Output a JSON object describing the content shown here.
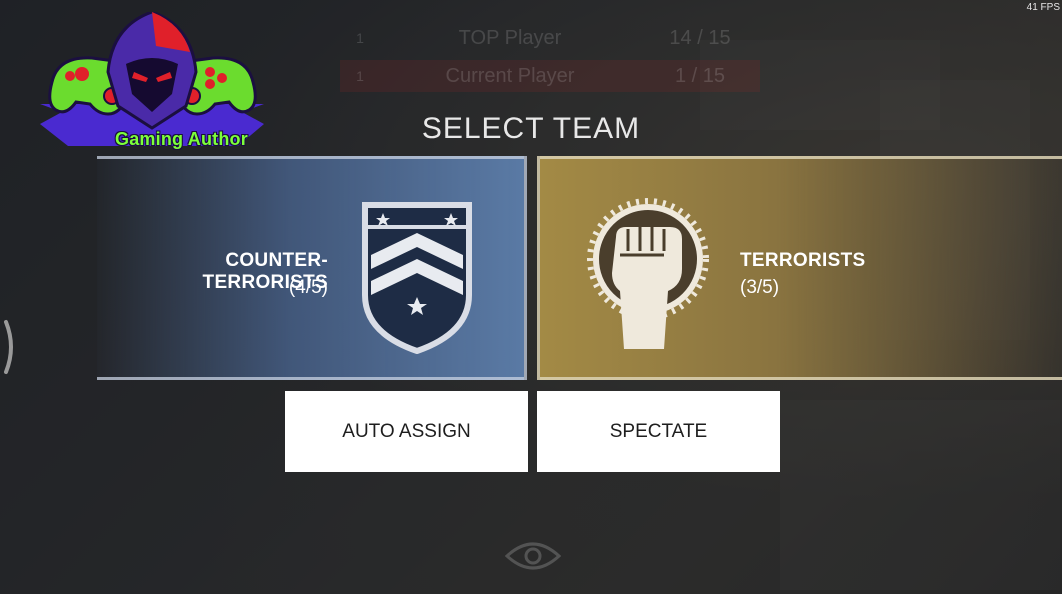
{
  "hud": {
    "fps": "41 FPS"
  },
  "scoreboard": {
    "rows": [
      {
        "rank": "1",
        "name": "TOP Player",
        "score": "14 / 15"
      },
      {
        "rank": "1",
        "name": "Current Player",
        "score": "1 / 15"
      }
    ]
  },
  "logo": {
    "text": "Gaming Author"
  },
  "title": "SELECT TEAM",
  "teams": {
    "ct": {
      "name": "COUNTER-TERRORISTS",
      "count": "(4/5)",
      "color": "#5a7aa5",
      "icon": "chevron-shield-icon"
    },
    "t": {
      "name": "TERRORISTS",
      "count": "(3/5)",
      "color": "#a38a45",
      "icon": "raised-fist-icon"
    }
  },
  "actions": {
    "auto_assign": "AUTO ASSIGN",
    "spectate": "SPECTATE"
  }
}
